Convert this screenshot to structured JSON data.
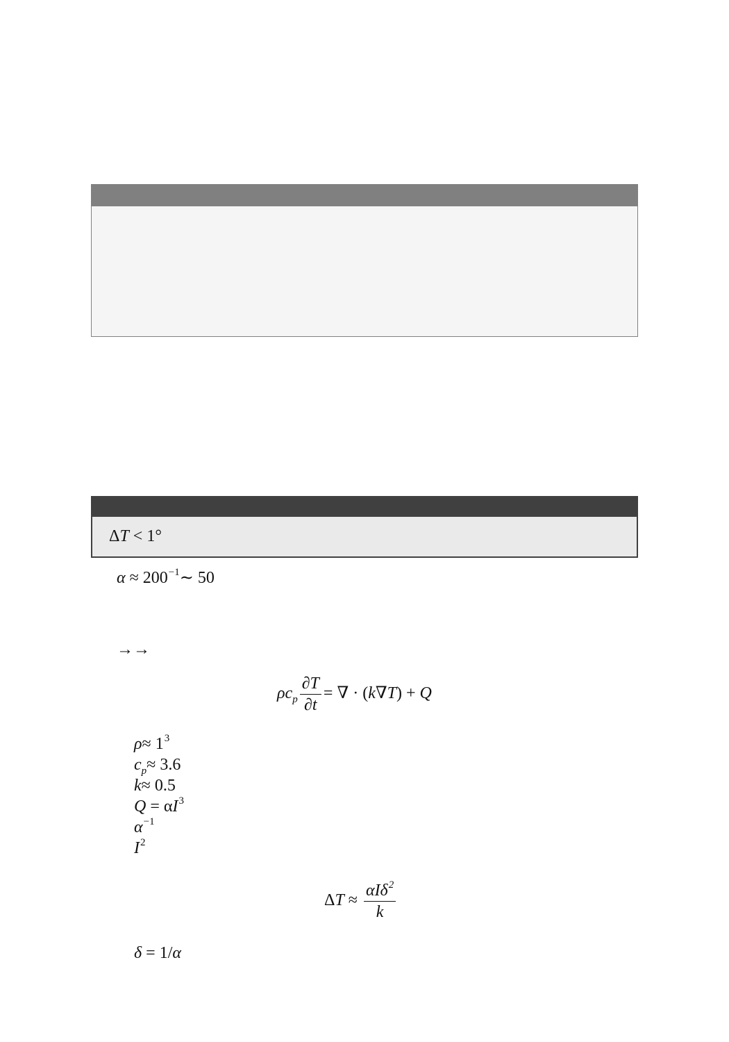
{
  "box1": {},
  "box2": {
    "condition": {
      "delta": "Δ",
      "T": "T",
      "rel": " < 1",
      "deg": "°"
    }
  },
  "alpha_line": {
    "alpha": "α",
    "approx": " ≈ 200",
    "exp": "−1",
    "rest": "∼ 50"
  },
  "arrows": "→→",
  "heat_equation": {
    "rho": "ρ",
    "c": "c",
    "p": "p",
    "num": "∂T",
    "den": "∂t",
    "rhs_start": "= ∇ · (",
    "k": "k",
    "nabla": "∇",
    "T": "T",
    "rhs_end": ") + ",
    "Q": "Q"
  },
  "params": [
    {
      "sym": "ρ",
      "text": "≈ 1",
      "sup": "3"
    },
    {
      "sym": "c",
      "sub": "p",
      "text": "≈ 3.6"
    },
    {
      "sym": "k",
      "text": "≈ 0.5"
    },
    {
      "sym": "Q",
      "text": " = α",
      "sym2": "I",
      "sup": "3"
    },
    {
      "sym": "α",
      "sup": "−1"
    },
    {
      "sym": "I",
      "sup": "2"
    }
  ],
  "delta_T_equation": {
    "lhs": "Δ",
    "T": "T",
    "approx": " ≈ ",
    "num": "αIδ",
    "num_sup": "2",
    "den": "k"
  },
  "delta_def": {
    "sym": "δ",
    "text": " = 1/",
    "alpha": "α"
  }
}
